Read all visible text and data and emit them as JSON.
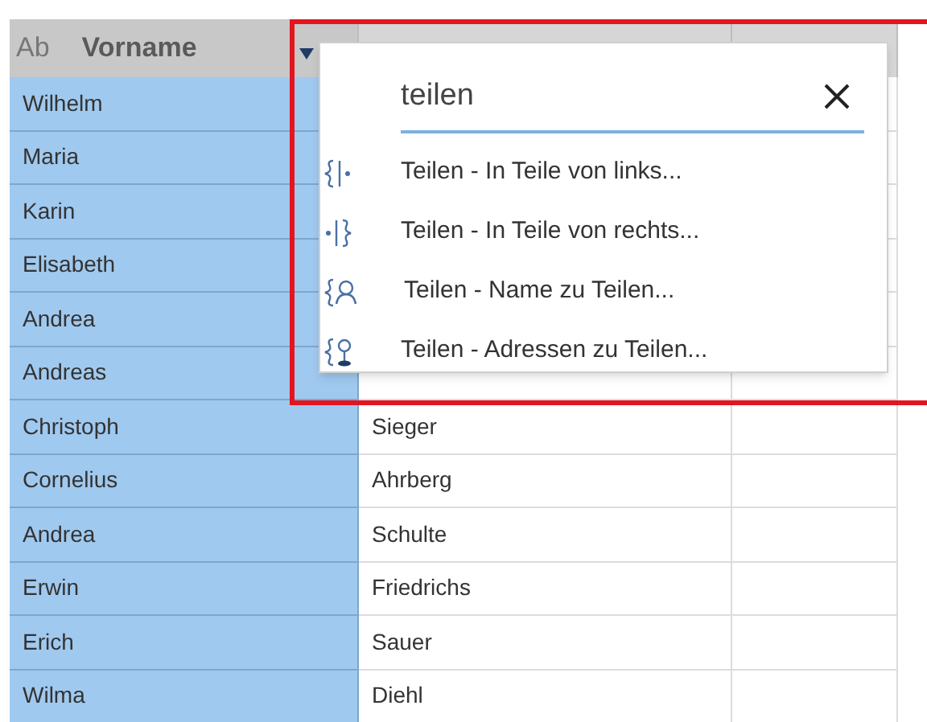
{
  "table": {
    "columns": [
      {
        "type_label": "Ab",
        "label": "Vorname",
        "selected": true
      },
      {
        "selected": false
      },
      {
        "selected": false
      }
    ],
    "rows": [
      {
        "first": "Wilhelm"
      },
      {
        "first": "Maria"
      },
      {
        "first": "Karin"
      },
      {
        "first": "Elisabeth"
      },
      {
        "first": "Andrea"
      },
      {
        "first": "Andreas"
      },
      {
        "first": "Christoph",
        "last": "Sieger"
      },
      {
        "first": "Cornelius",
        "last": "Ahrberg"
      },
      {
        "first": "Andrea",
        "last": "Schulte"
      },
      {
        "first": "Erwin",
        "last": "Friedrichs"
      },
      {
        "first": "Erich",
        "last": "Sauer"
      },
      {
        "first": "Wilma",
        "last": "Diehl"
      }
    ]
  },
  "search_popup": {
    "query": "teilen",
    "results": [
      {
        "kind": "split-left",
        "label": "Teilen - In Teile von links..."
      },
      {
        "kind": "split-right",
        "label": "Teilen - In Teile von rechts..."
      },
      {
        "kind": "split-name",
        "label": "Teilen - Name zu Teilen..."
      },
      {
        "kind": "split-address",
        "label": "Teilen - Adressen zu Teilen..."
      }
    ]
  }
}
